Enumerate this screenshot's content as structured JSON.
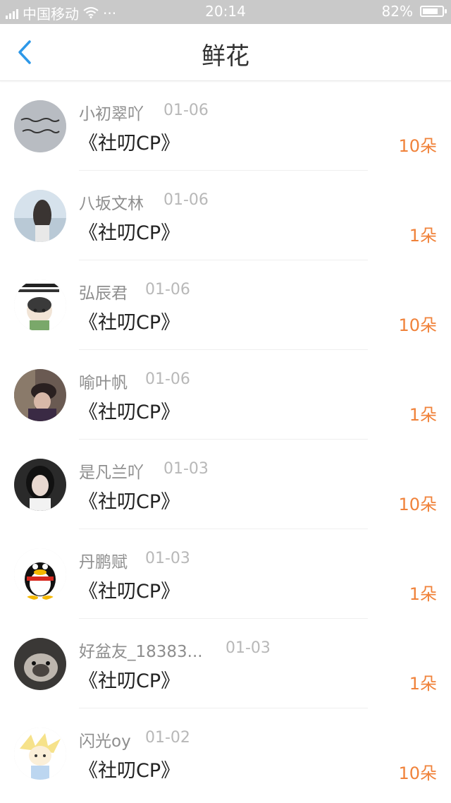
{
  "status_bar": {
    "carrier": "中国移动",
    "dots": "···",
    "time": "20:14",
    "battery": "82%",
    "battery_level": 0.82
  },
  "nav": {
    "title": "鲜花"
  },
  "colors": {
    "accent": "#f0823a",
    "back_arrow": "#2d98e8"
  },
  "items": [
    {
      "name": "小初翠吖",
      "date": "01-06",
      "work": "《社叨CP》",
      "count": "10朵"
    },
    {
      "name": "八坂文林",
      "date": "01-06",
      "work": "《社叨CP》",
      "count": "1朵"
    },
    {
      "name": "弘辰君",
      "date": "01-06",
      "work": "《社叨CP》",
      "count": "10朵"
    },
    {
      "name": "喻叶帆",
      "date": "01-06",
      "work": "《社叨CP》",
      "count": "1朵"
    },
    {
      "name": "是凡兰吖",
      "date": "01-03",
      "work": "《社叨CP》",
      "count": "10朵"
    },
    {
      "name": "丹鹏赋",
      "date": "01-03",
      "work": "《社叨CP》",
      "count": "1朵"
    },
    {
      "name": "好盆友_18383...",
      "date": "01-03",
      "work": "《社叨CP》",
      "count": "1朵"
    },
    {
      "name": "闪光oy",
      "date": "01-02",
      "work": "《社叨CP》",
      "count": "10朵"
    }
  ]
}
